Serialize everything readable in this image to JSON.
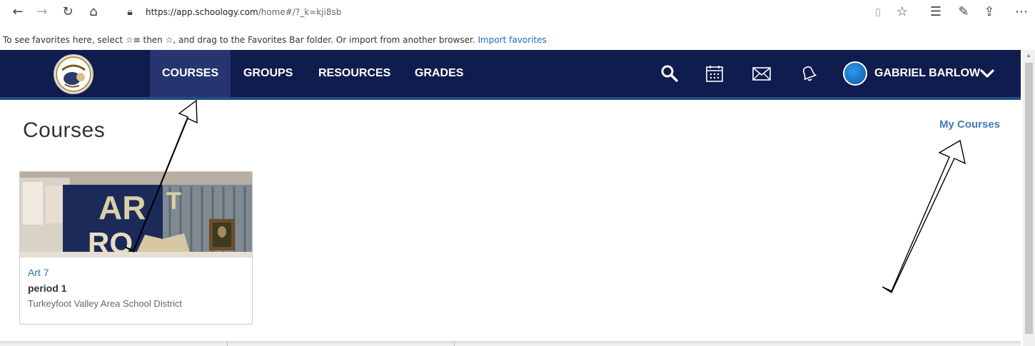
{
  "browser": {
    "url_main": "https://app.schoology.com",
    "url_rest": "/home#/?_k=kji8sb",
    "favorites_text": "To see favorites here, select ☆≡ then ☆, and drag to the Favorites Bar folder. Or import from another browser.",
    "import_link": "Import favorites"
  },
  "nav": {
    "items": [
      {
        "label": "COURSES",
        "active": true
      },
      {
        "label": "GROUPS",
        "active": false
      },
      {
        "label": "RESOURCES",
        "active": false
      },
      {
        "label": "GRADES",
        "active": false
      }
    ],
    "user_name": "GABRIEL BARLOW"
  },
  "main": {
    "title": "Courses",
    "my_courses_link": "My Courses",
    "course": {
      "title": "Art 7",
      "section": "period 1",
      "school": "Turkeyfoot Valley Area School District"
    }
  },
  "colors": {
    "nav_bg": "#101c4d",
    "nav_active": "#263570",
    "link_blue": "#1b77c5"
  }
}
